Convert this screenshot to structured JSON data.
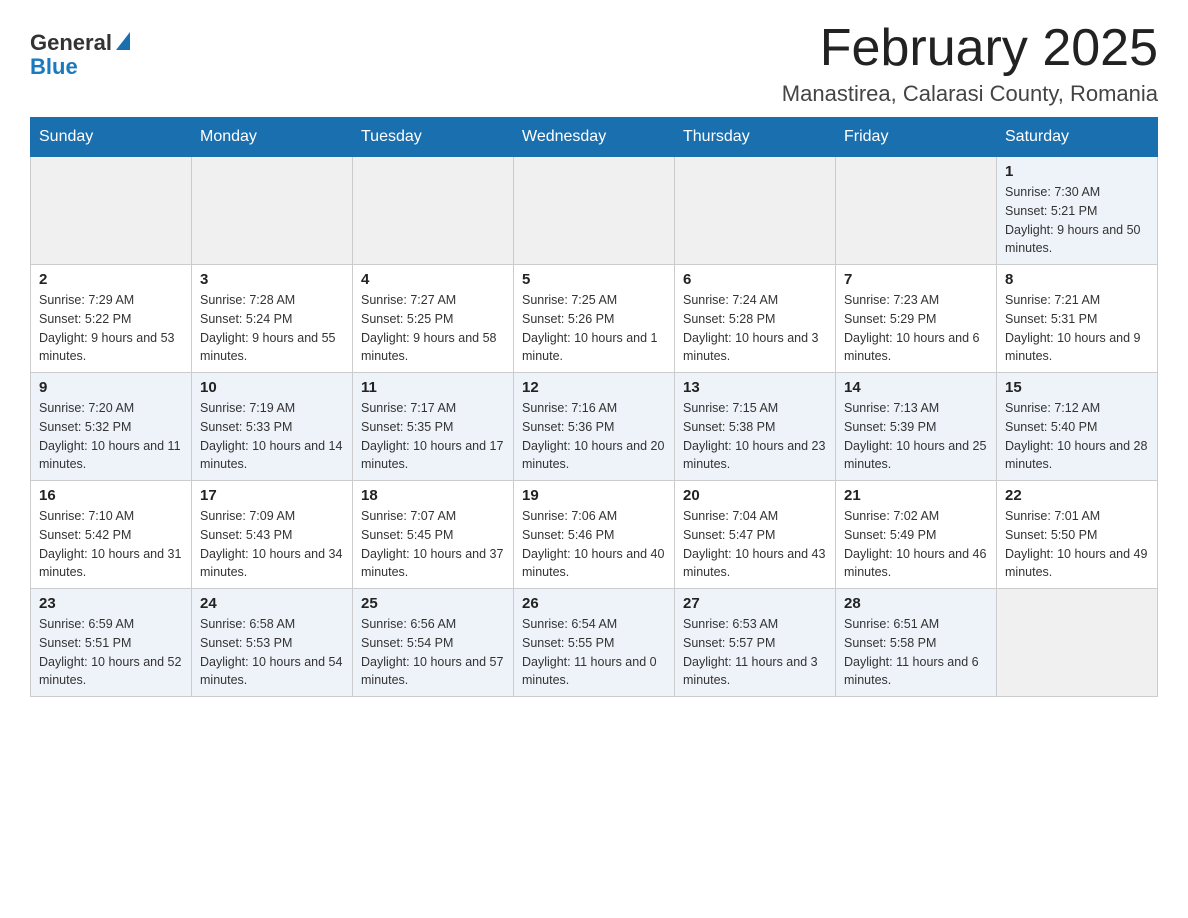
{
  "header": {
    "logo_general": "General",
    "logo_blue": "Blue",
    "month_title": "February 2025",
    "location": "Manastirea, Calarasi County, Romania"
  },
  "days_of_week": [
    "Sunday",
    "Monday",
    "Tuesday",
    "Wednesday",
    "Thursday",
    "Friday",
    "Saturday"
  ],
  "weeks": [
    {
      "days": [
        {
          "number": "",
          "info": ""
        },
        {
          "number": "",
          "info": ""
        },
        {
          "number": "",
          "info": ""
        },
        {
          "number": "",
          "info": ""
        },
        {
          "number": "",
          "info": ""
        },
        {
          "number": "",
          "info": ""
        },
        {
          "number": "1",
          "info": "Sunrise: 7:30 AM\nSunset: 5:21 PM\nDaylight: 9 hours and 50 minutes."
        }
      ]
    },
    {
      "days": [
        {
          "number": "2",
          "info": "Sunrise: 7:29 AM\nSunset: 5:22 PM\nDaylight: 9 hours and 53 minutes."
        },
        {
          "number": "3",
          "info": "Sunrise: 7:28 AM\nSunset: 5:24 PM\nDaylight: 9 hours and 55 minutes."
        },
        {
          "number": "4",
          "info": "Sunrise: 7:27 AM\nSunset: 5:25 PM\nDaylight: 9 hours and 58 minutes."
        },
        {
          "number": "5",
          "info": "Sunrise: 7:25 AM\nSunset: 5:26 PM\nDaylight: 10 hours and 1 minute."
        },
        {
          "number": "6",
          "info": "Sunrise: 7:24 AM\nSunset: 5:28 PM\nDaylight: 10 hours and 3 minutes."
        },
        {
          "number": "7",
          "info": "Sunrise: 7:23 AM\nSunset: 5:29 PM\nDaylight: 10 hours and 6 minutes."
        },
        {
          "number": "8",
          "info": "Sunrise: 7:21 AM\nSunset: 5:31 PM\nDaylight: 10 hours and 9 minutes."
        }
      ]
    },
    {
      "days": [
        {
          "number": "9",
          "info": "Sunrise: 7:20 AM\nSunset: 5:32 PM\nDaylight: 10 hours and 11 minutes."
        },
        {
          "number": "10",
          "info": "Sunrise: 7:19 AM\nSunset: 5:33 PM\nDaylight: 10 hours and 14 minutes."
        },
        {
          "number": "11",
          "info": "Sunrise: 7:17 AM\nSunset: 5:35 PM\nDaylight: 10 hours and 17 minutes."
        },
        {
          "number": "12",
          "info": "Sunrise: 7:16 AM\nSunset: 5:36 PM\nDaylight: 10 hours and 20 minutes."
        },
        {
          "number": "13",
          "info": "Sunrise: 7:15 AM\nSunset: 5:38 PM\nDaylight: 10 hours and 23 minutes."
        },
        {
          "number": "14",
          "info": "Sunrise: 7:13 AM\nSunset: 5:39 PM\nDaylight: 10 hours and 25 minutes."
        },
        {
          "number": "15",
          "info": "Sunrise: 7:12 AM\nSunset: 5:40 PM\nDaylight: 10 hours and 28 minutes."
        }
      ]
    },
    {
      "days": [
        {
          "number": "16",
          "info": "Sunrise: 7:10 AM\nSunset: 5:42 PM\nDaylight: 10 hours and 31 minutes."
        },
        {
          "number": "17",
          "info": "Sunrise: 7:09 AM\nSunset: 5:43 PM\nDaylight: 10 hours and 34 minutes."
        },
        {
          "number": "18",
          "info": "Sunrise: 7:07 AM\nSunset: 5:45 PM\nDaylight: 10 hours and 37 minutes."
        },
        {
          "number": "19",
          "info": "Sunrise: 7:06 AM\nSunset: 5:46 PM\nDaylight: 10 hours and 40 minutes."
        },
        {
          "number": "20",
          "info": "Sunrise: 7:04 AM\nSunset: 5:47 PM\nDaylight: 10 hours and 43 minutes."
        },
        {
          "number": "21",
          "info": "Sunrise: 7:02 AM\nSunset: 5:49 PM\nDaylight: 10 hours and 46 minutes."
        },
        {
          "number": "22",
          "info": "Sunrise: 7:01 AM\nSunset: 5:50 PM\nDaylight: 10 hours and 49 minutes."
        }
      ]
    },
    {
      "days": [
        {
          "number": "23",
          "info": "Sunrise: 6:59 AM\nSunset: 5:51 PM\nDaylight: 10 hours and 52 minutes."
        },
        {
          "number": "24",
          "info": "Sunrise: 6:58 AM\nSunset: 5:53 PM\nDaylight: 10 hours and 54 minutes."
        },
        {
          "number": "25",
          "info": "Sunrise: 6:56 AM\nSunset: 5:54 PM\nDaylight: 10 hours and 57 minutes."
        },
        {
          "number": "26",
          "info": "Sunrise: 6:54 AM\nSunset: 5:55 PM\nDaylight: 11 hours and 0 minutes."
        },
        {
          "number": "27",
          "info": "Sunrise: 6:53 AM\nSunset: 5:57 PM\nDaylight: 11 hours and 3 minutes."
        },
        {
          "number": "28",
          "info": "Sunrise: 6:51 AM\nSunset: 5:58 PM\nDaylight: 11 hours and 6 minutes."
        },
        {
          "number": "",
          "info": ""
        }
      ]
    }
  ]
}
